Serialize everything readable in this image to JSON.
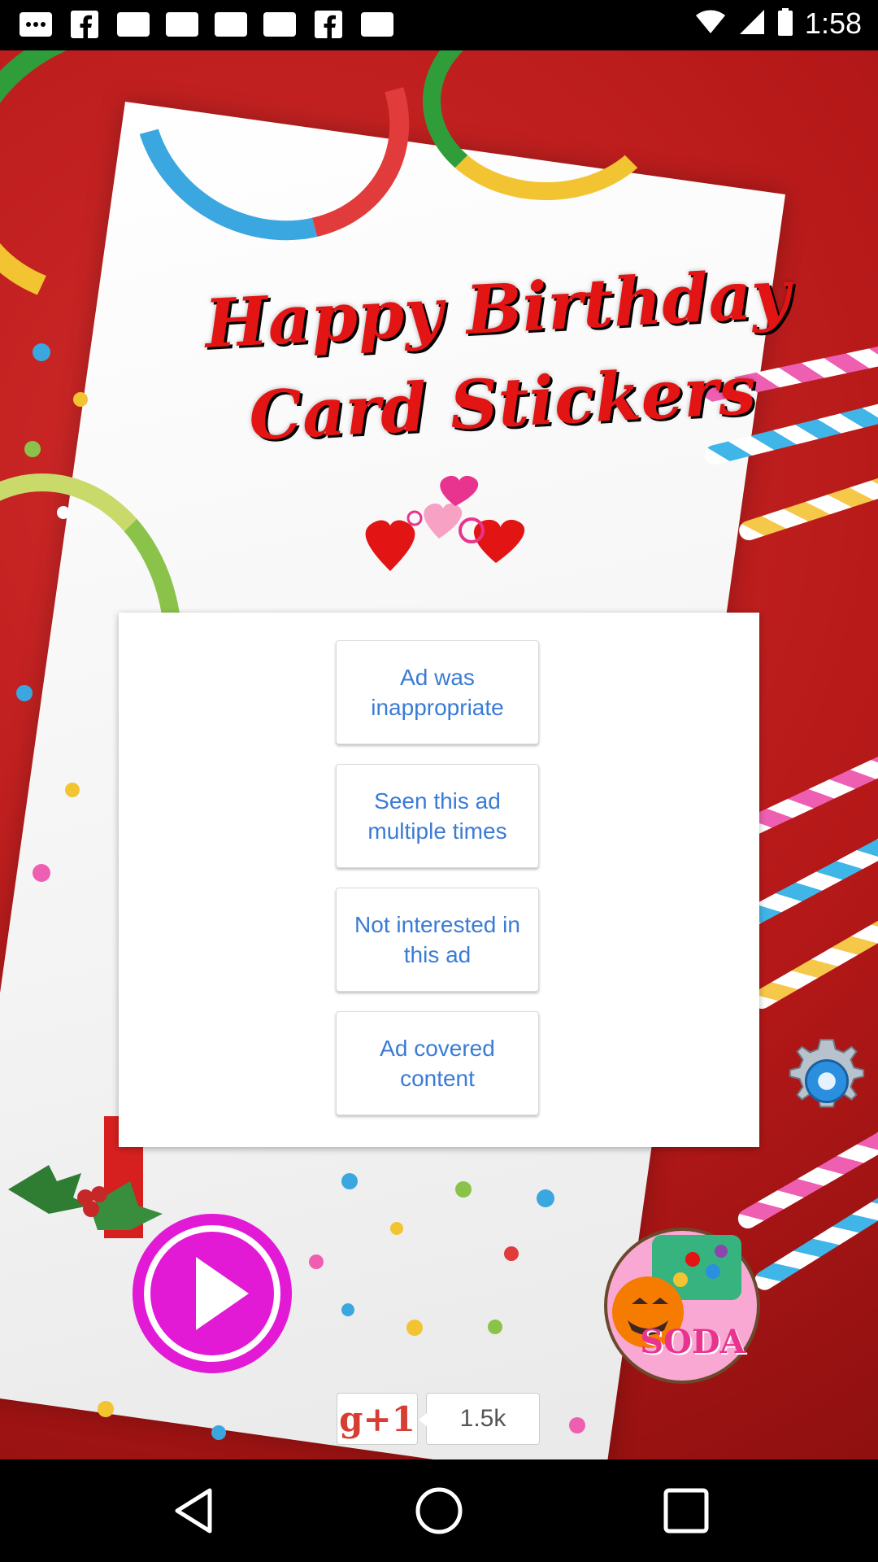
{
  "status_bar": {
    "time": "1:58",
    "left_icons": [
      "more-icon",
      "facebook-icon",
      "image-icon",
      "image-icon",
      "image-icon",
      "image-icon",
      "facebook-icon",
      "image-icon"
    ],
    "right_icons": [
      "wifi-icon",
      "signal-icon",
      "battery-icon"
    ]
  },
  "app": {
    "title_line1": "Happy Birthday",
    "title_line2": "Card Stickers"
  },
  "ad_feedback_dialog": {
    "options": [
      "Ad was inappropriate",
      "Seen this ad multiple times",
      "Not interested in this ad",
      "Ad covered content"
    ]
  },
  "controls": {
    "settings_icon": "gear-icon",
    "play_icon": "play-icon",
    "promo_label": "SODA",
    "gplus_label": "g+1",
    "gplus_count": "1.5k"
  },
  "nav_bar": {
    "icons": [
      "back-icon",
      "home-icon",
      "recent-apps-icon"
    ]
  },
  "colors": {
    "title_red": "#e21414",
    "dialog_text_blue": "#3a7bd5",
    "play_magenta": "#e21ad6",
    "background_red": "#b51818"
  }
}
